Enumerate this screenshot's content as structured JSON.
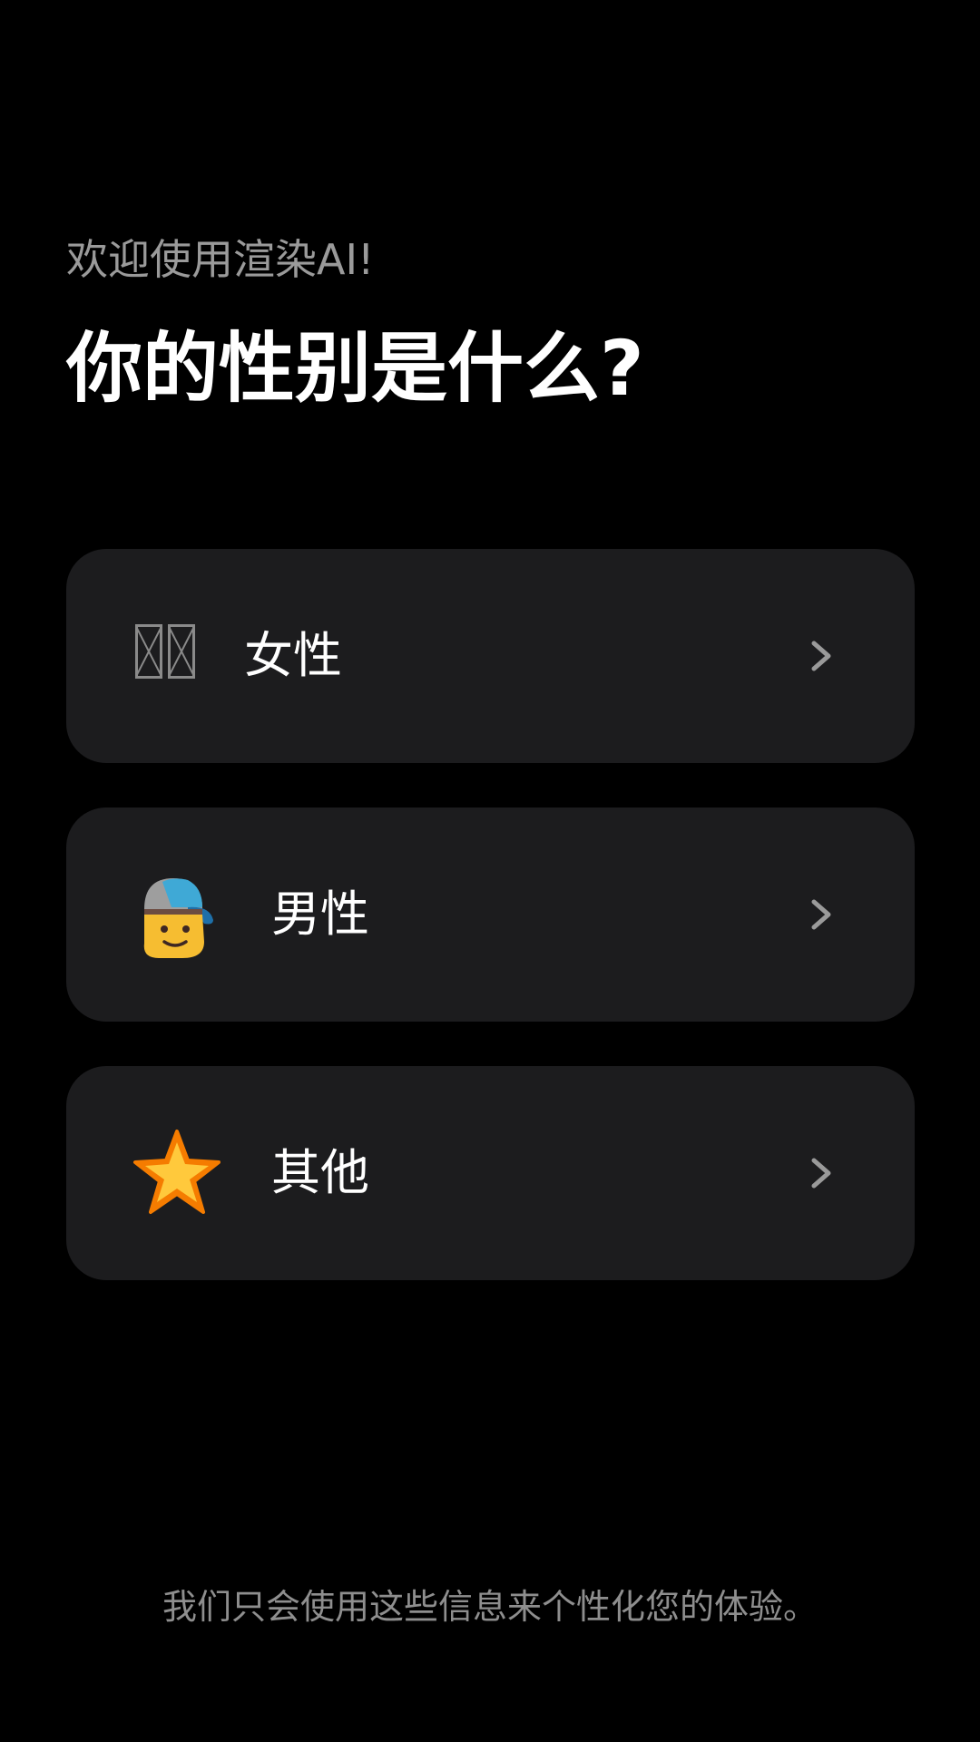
{
  "header": {
    "welcome": "欢迎使用渲染AI!",
    "question": "你的性别是什么?"
  },
  "options": [
    {
      "label": "女性",
      "icon": "missing-glyph-icon"
    },
    {
      "label": "男性",
      "icon": "boy-with-cap-emoji-icon"
    },
    {
      "label": "其他",
      "icon": "star-emoji-icon"
    }
  ],
  "footer": {
    "note": "我们只会使用这些信息来个性化您的体验。"
  },
  "colors": {
    "background": "#000000",
    "card": "#1c1c1e",
    "secondary_text": "#9a9a9a",
    "chevron": "#9a9a9a",
    "star": "#ffb62e"
  }
}
